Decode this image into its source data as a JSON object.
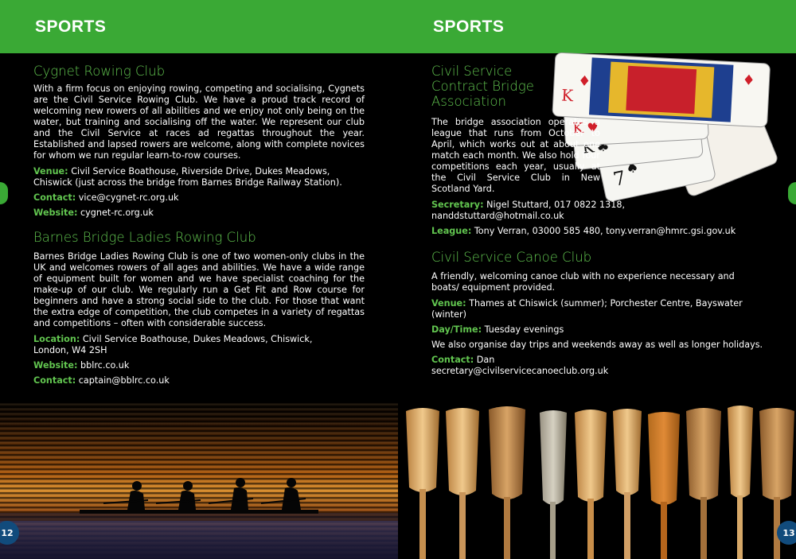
{
  "left": {
    "header": "SPORTS",
    "page_number": "12",
    "clubs": [
      {
        "name": "Cygnet Rowing Club",
        "body": "With a firm focus on enjoying rowing, competing and socialising, Cygnets are the Civil Service Rowing Club. We have a proud track record of welcoming new rowers of all abilities and we enjoy not only being on the water, but training and socialising off the water. We represent our club and the Civil Service at races ad regattas throughout the year. Established and lapsed rowers are welcome, along with complete novices for whom we run regular learn-to-row courses.",
        "details": [
          {
            "label": "Venue:",
            "value": "Civil Service Boathouse, Riverside Drive, Dukes Meadows, Chiswick (just across the bridge from Barnes Bridge Railway Station)."
          },
          {
            "label": "Contact:",
            "value": "vice@cygnet-rc.org.uk"
          },
          {
            "label": "Website:",
            "value": "cygnet-rc.org.uk"
          }
        ]
      },
      {
        "name": "Barnes Bridge Ladies Rowing Club",
        "body": "Barnes Bridge Ladies Rowing Club is one of two women-only clubs in the UK and welcomes rowers of all ages and abilities. We have a wide range of equipment built for women and we have specialist coaching for the make-up of our club. We regularly run a Get Fit and Row course for beginners and have a strong social side to the club. For those that want the extra edge of competition, the club competes in a variety of regattas and competitions – often with considerable success.",
        "details": [
          {
            "label": "Location:",
            "value": "Civil Service Boathouse, Dukes Meadows, Chiswick, London, W4 2SH"
          },
          {
            "label": "Website:",
            "value": "bblrc.co.uk"
          },
          {
            "label": "Contact:",
            "value": "captain@bblrc.co.uk"
          }
        ]
      }
    ]
  },
  "right": {
    "header": "SPORTS",
    "page_number": "13",
    "clubs": [
      {
        "name": "Civil Service Contract Bridge Association",
        "body": "The bridge association operates a league that runs from October to April, which works out at about one match each month. We also hold four competitions each year, usually at the Civil Service Club in New Scotland Yard.",
        "details": [
          {
            "label": "Secretary:",
            "value": "Nigel Stuttard, 017 0822 1318, nanddstuttard@hotmail.co.uk"
          },
          {
            "label": "League:",
            "value": "Tony Verran, 03000 585 480, tony.verran@hmrc.gsi.gov.uk"
          }
        ]
      },
      {
        "name": "Civil Service Canoe Club",
        "body": "A friendly, welcoming canoe club with no experience necessary and boats/ equipment provided.",
        "details": [
          {
            "label": "Venue:",
            "value": "Thames at Chiswick (summer); Porchester Centre, Bayswater (winter)"
          },
          {
            "label": "Day/Time:",
            "value": "Tuesday evenings"
          },
          {
            "label": "",
            "value": "We also organise day trips and weekends away as well as longer holidays."
          },
          {
            "label": "Contact:",
            "value": "Dan secretary@civilservicecanoeclub.org.uk"
          }
        ]
      }
    ]
  },
  "cards": {
    "card_1": "K",
    "card_2": "K",
    "card_3": "K",
    "card_4": "7",
    "card_5": "7"
  },
  "colors": {
    "brand_green": "#3aa935",
    "heading_green": "#61c44f",
    "page_badge": "#114b7c"
  }
}
